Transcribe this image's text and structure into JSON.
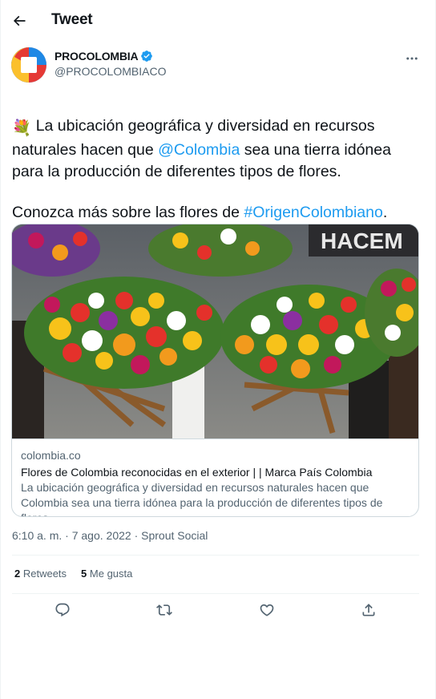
{
  "header": {
    "title": "Tweet",
    "back_icon": "arrow-left-icon"
  },
  "author": {
    "name": "PROCOLOMBIA",
    "handle": "@PROCOLOMBIACO",
    "verified": true,
    "avatar_colors": [
      "#0a2c6a",
      "#fcd116",
      "#ce1126",
      "#2a8bd8"
    ]
  },
  "tweet": {
    "emoji_flag": "colombia-flag",
    "emoji_bouquet": "💐",
    "text_1": " La ubicación geográfica y diversidad en recursos naturales hacen que ",
    "mention": "@Colombia",
    "text_2": " sea una tierra idónea para la producción de diferentes tipos de flores.",
    "text_3": "Conozca más sobre las flores de ",
    "hashtag": "#OrigenColombiano",
    "text_4": ".",
    "emoji_point": "👇"
  },
  "card": {
    "domain": "colombia.co",
    "title": "Flores de Colombia reconocidas en el exterior | | Marca País Colombia",
    "description": "La ubicación geográfica y diversidad en recursos naturales hacen que Colombia sea una tierra idónea para la producción de diferentes tipos de flores",
    "image_banner_text": "HACEM"
  },
  "meta": {
    "time": "6:10 a. m.",
    "separator": " · ",
    "date": "7 ago. 2022",
    "source": "Sprout Social"
  },
  "stats": {
    "retweets_count": "2",
    "retweets_label": " Retweets",
    "likes_count": "5",
    "likes_label": " Me gusta"
  },
  "actions": {
    "reply_icon": "reply-icon",
    "retweet_icon": "retweet-icon",
    "like_icon": "heart-icon",
    "share_icon": "share-icon"
  },
  "colors": {
    "link": "#1d9bf0",
    "verified": "#1d9bf0",
    "text": "#0f1419",
    "muted": "#536471",
    "border": "#cfd9de"
  }
}
